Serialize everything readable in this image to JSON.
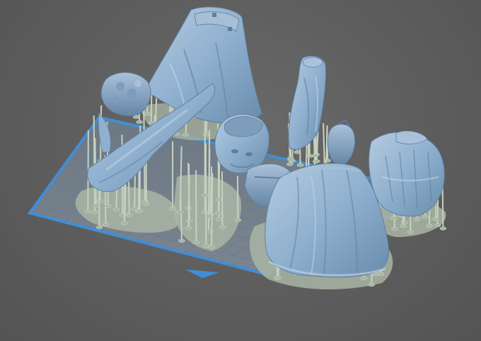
{
  "app": {
    "view": "3d-print-slicer-viewport",
    "scene": "resin-model-parts-with-supports-on-build-plate"
  },
  "colors": {
    "background": "#5e5e5e",
    "build_plate_border": "#3f8fd6",
    "build_plate_fill": "#767f88",
    "grid_line": "#5d7ea3",
    "model": "#8fb0cf",
    "model_shadow": "#5f7f9e",
    "model_highlight": "#c3d6e8",
    "support": "#c6d1c0",
    "support_base": "#a9b5a4",
    "plate_front_marker": "#3f8fd6"
  },
  "objects": [
    {
      "name": "cape-part"
    },
    {
      "name": "arm-part"
    },
    {
      "name": "fur-collar-part"
    },
    {
      "name": "head-part"
    },
    {
      "name": "sleeve-part"
    },
    {
      "name": "skirt-part"
    },
    {
      "name": "vest-part"
    },
    {
      "name": "hand-part"
    }
  ]
}
